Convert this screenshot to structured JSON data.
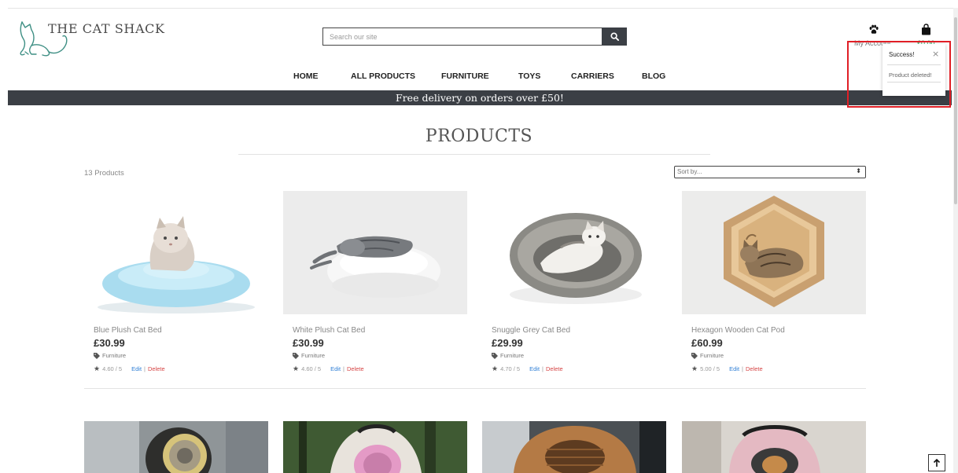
{
  "brand": {
    "name": "THE CAT SHACK"
  },
  "search": {
    "placeholder": "Search our site"
  },
  "header": {
    "account_label": "My Account",
    "bag_total": "£0.00"
  },
  "nav": {
    "items": [
      "HOME",
      "ALL PRODUCTS",
      "FURNITURE",
      "TOYS",
      "CARRIERS",
      "BLOG"
    ]
  },
  "banner": {
    "text": "Free delivery on orders over £50!"
  },
  "page": {
    "title": "PRODUCTS",
    "count": "13 Products",
    "sort_label": "Sort by..."
  },
  "products": [
    {
      "name": "Blue Plush Cat Bed",
      "price": "£30.99",
      "category": "Furniture",
      "rating": "4.60 / 5",
      "edit": "Edit",
      "sep": "|",
      "delete": "Delete"
    },
    {
      "name": "White Plush Cat Bed",
      "price": "£30.99",
      "category": "Furniture",
      "rating": "4.60 / 5",
      "edit": "Edit",
      "sep": "|",
      "delete": "Delete"
    },
    {
      "name": "Snuggle Grey Cat Bed",
      "price": "£29.99",
      "category": "Furniture",
      "rating": "4.70 / 5",
      "edit": "Edit",
      "sep": "|",
      "delete": "Delete"
    },
    {
      "name": "Hexagon Wooden Cat Pod",
      "price": "£60.99",
      "category": "Furniture",
      "rating": "5.00 / 5",
      "edit": "Edit",
      "sep": "|",
      "delete": "Delete"
    }
  ],
  "toast": {
    "title": "Success!",
    "close": "×",
    "message": "Product deleted!"
  },
  "icons": {
    "search": "search-icon",
    "paw": "paw-icon",
    "bag": "shopping-bag-icon",
    "tag": "tag-icon",
    "star": "star-icon",
    "arrow_up": "arrow-up-icon"
  },
  "colors": {
    "banner": "#3b3f45",
    "edit": "#2f7fd6",
    "delete": "#d64545",
    "highlight": "#e01f26"
  }
}
